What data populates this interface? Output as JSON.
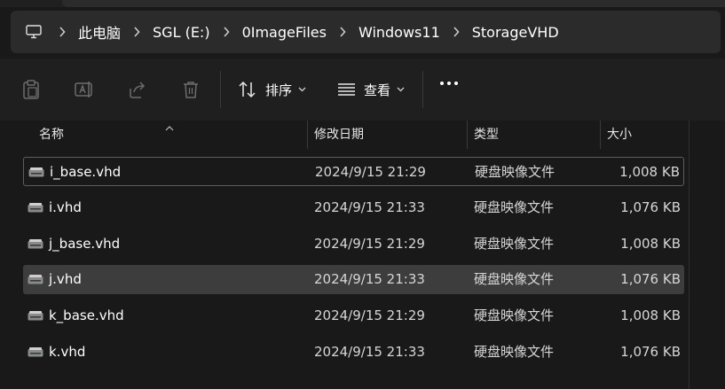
{
  "breadcrumb": {
    "items": [
      "此电脑",
      "SGL (E:)",
      "0ImageFiles",
      "Windows11",
      "StorageVHD"
    ]
  },
  "toolbar": {
    "sort_label": "排序",
    "view_label": "查看"
  },
  "columns": {
    "name": "名称",
    "date": "修改日期",
    "type": "类型",
    "size": "大小"
  },
  "files": [
    {
      "name": "i_base.vhd",
      "date": "2024/9/15 21:29",
      "type": "硬盘映像文件",
      "size": "1,008 KB"
    },
    {
      "name": "i.vhd",
      "date": "2024/9/15 21:33",
      "type": "硬盘映像文件",
      "size": "1,076 KB"
    },
    {
      "name": "j_base.vhd",
      "date": "2024/9/15 21:29",
      "type": "硬盘映像文件",
      "size": "1,008 KB"
    },
    {
      "name": "j.vhd",
      "date": "2024/9/15 21:33",
      "type": "硬盘映像文件",
      "size": "1,076 KB"
    },
    {
      "name": "k_base.vhd",
      "date": "2024/9/15 21:29",
      "type": "硬盘映像文件",
      "size": "1,008 KB"
    },
    {
      "name": "k.vhd",
      "date": "2024/9/15 21:33",
      "type": "硬盘映像文件",
      "size": "1,076 KB"
    }
  ],
  "colors": {
    "background": "#191919",
    "selected_row": "#3d3d3d",
    "focus_border": "#5d5d5d",
    "address_bar": "#2b2b2b"
  }
}
